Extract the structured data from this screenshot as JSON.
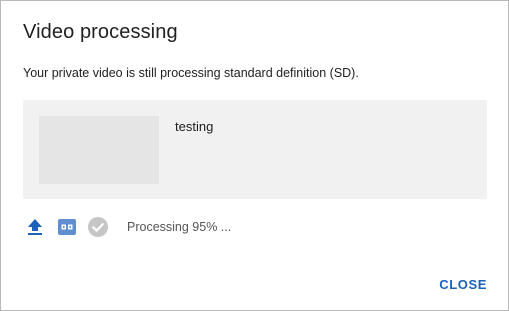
{
  "dialog": {
    "title": "Video processing",
    "message": "Your private video is still processing standard definition (SD).",
    "video": {
      "title": "testing"
    },
    "status": {
      "icons": [
        "upload-icon",
        "sd-icon",
        "check-circle-icon"
      ],
      "text": "Processing 95% ..."
    },
    "close_label": "CLOSE"
  },
  "colors": {
    "accent": "#1c62b9",
    "upload_icon": "#1c62b9",
    "sd_icon": "#5f8fd0",
    "check_icon": "#c6c6c6",
    "card_bg": "#f1f1f1",
    "thumb_bg": "#e5e5e5"
  }
}
